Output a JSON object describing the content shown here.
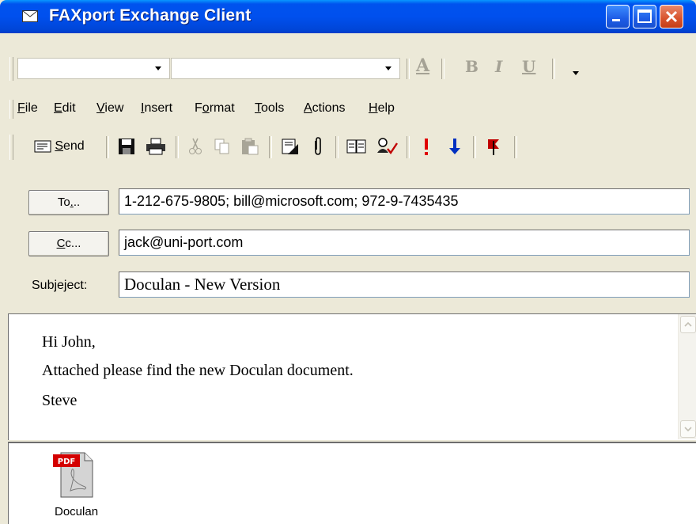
{
  "window": {
    "title": "FAXport Exchange Client"
  },
  "format_toolbar": {
    "font_name": "",
    "font_size": "",
    "buttons": [
      "font-color",
      "bold",
      "italic",
      "underline",
      "more"
    ]
  },
  "menu": {
    "items": [
      {
        "label": "File",
        "accel": "F",
        "rest": "ile"
      },
      {
        "label": "Edit",
        "accel": "E",
        "rest": "dit"
      },
      {
        "label": "View",
        "accel": "V",
        "rest": "iew"
      },
      {
        "label": "Insert",
        "accel": "I",
        "rest": "nsert"
      },
      {
        "label": "Format",
        "pre": "F",
        "accel": "o",
        "rest": "rmat"
      },
      {
        "label": "Tools",
        "accel": "T",
        "rest": "ools"
      },
      {
        "label": "Actions",
        "accel": "A",
        "rest": "ctions"
      },
      {
        "label": "Help",
        "accel": "H",
        "rest": "elp"
      }
    ]
  },
  "standard_toolbar": {
    "send_pre": "",
    "send_accel": "S",
    "send_rest": "end",
    "icons": [
      "save-icon",
      "print-icon",
      "cut-icon",
      "copy-icon",
      "paste-icon",
      "insert-file-icon",
      "attach-icon",
      "address-book-icon",
      "check-names-icon",
      "importance-high-icon",
      "importance-low-icon",
      "flag-icon"
    ]
  },
  "addressing": {
    "to_button_pre": "To",
    "to_button_accel": ".",
    "to_button_rest": "..",
    "to_value": "1-212-675-9805; bill@microsoft.com; 972-9-7435435",
    "cc_button_accel": "C",
    "cc_button_rest": "c...",
    "cc_value": "jack@uni-port.com",
    "subject_label_pre": "Subje",
    "subject_label_accel": "j",
    "subject_label_rest": "ect:",
    "subject_value": "Doculan - New Version"
  },
  "message": {
    "lines": [
      "Hi John,",
      "Attached please find the new Doculan document.",
      "Steve"
    ]
  },
  "attachment": {
    "badge": "PDF",
    "name": "Doculan"
  }
}
